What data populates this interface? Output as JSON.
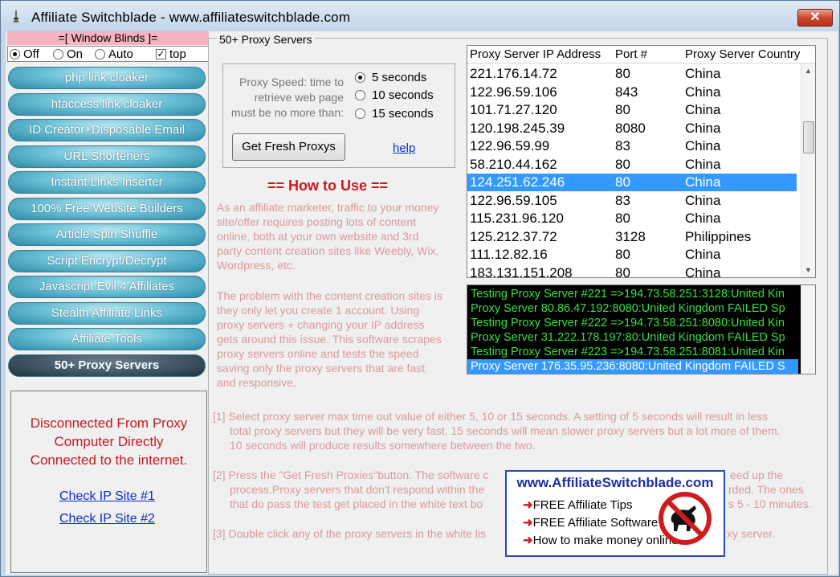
{
  "window": {
    "title": "Affiliate Switchblade - www.affiliateswitchblade.com",
    "close_label": "✕"
  },
  "sidebar": {
    "blinds_title": "=[ Window Blinds ]=",
    "blinds_options": [
      "Off",
      "On",
      "Auto"
    ],
    "blinds_selected": "Off",
    "top_label": "top",
    "top_checked": true,
    "nav": [
      {
        "label": "php link cloaker"
      },
      {
        "label": "htaccess link cloaker"
      },
      {
        "label": "ID Creator+Disposable Email"
      },
      {
        "label": "URL Shorteners"
      },
      {
        "label": "Instant Links Inserter"
      },
      {
        "label": "100% Free Website Builders"
      },
      {
        "label": "Article Spin Shuffle"
      },
      {
        "label": "Script Encrypt/Decrypt"
      },
      {
        "label": "Javascript Evil 4 Affiliates"
      },
      {
        "label": "Stealth Affiliate Links"
      },
      {
        "label": "Affiliate Tools"
      },
      {
        "label": "50+ Proxy Servers"
      }
    ],
    "active_nav": "50+ Proxy Servers",
    "status": {
      "line1": "Disconnected From Proxy",
      "line2": "Computer Directly",
      "line3": "Connected to the internet."
    },
    "links": {
      "ip1": "Check IP Site #1",
      "ip2": "Check IP Site #2"
    }
  },
  "main": {
    "group_label": "50+ Proxy Servers",
    "speed": {
      "label_line1": "Proxy Speed: time to",
      "label_line2": "retrieve web page",
      "label_line3": "must be no more than:",
      "options": [
        "5 seconds",
        "10 seconds",
        "15 seconds"
      ],
      "selected": "5 seconds"
    },
    "fresh_button": "Get Fresh Proxys",
    "help_link": "help",
    "how_title": "== How to Use ==",
    "intro_paragraph": [
      "As an affiliate marketer, traffic to your money",
      "site/offer requires posting lots of content",
      "online, both at your own website and 3rd",
      "party content creation sites like Weebly, Wix,",
      "Wordpress, etc."
    ],
    "problem_paragraph": [
      "The problem with the content creation sites is",
      "they only let you create 1 account. Using",
      "proxy servers + changing your IP address",
      "gets around this issue. This software scrapes",
      "proxy servers online and tests the speed",
      "saving only the proxy servers that are fast",
      "and responsive."
    ],
    "step1": [
      "[1] Select proxy server max time out value of either 5, 10 or 15 seconds. A setting of 5 seconds will result in less",
      "total proxy servers but they will be very fast. 15 seconds will mean slower proxy servers but a lot more of them.",
      "10 seconds will produce results somewhere between the two."
    ],
    "step2": [
      "[2] Press the \"Get Fresh Proxies\"button. The software c",
      "process.Proxy servers that don't respond within the",
      "that do pass the test get placed in the white text bo"
    ],
    "step2_right": [
      "eed up the",
      "rded. The ones",
      "s 5 - 10 minutes."
    ],
    "step3": "[3] Double click any of the proxy servers in the white lis",
    "step3_right": "xy server.",
    "table": {
      "headers": [
        "Proxy Server IP Address",
        "Port #",
        "Proxy Server Country"
      ],
      "rows": [
        {
          "ip": "221.176.14.72",
          "port": "80",
          "country": "China"
        },
        {
          "ip": "122.96.59.106",
          "port": "843",
          "country": "China"
        },
        {
          "ip": "101.71.27.120",
          "port": "80",
          "country": "China"
        },
        {
          "ip": "120.198.245.39",
          "port": "8080",
          "country": "China"
        },
        {
          "ip": "122.96.59.99",
          "port": "83",
          "country": "China"
        },
        {
          "ip": "58.210.44.162",
          "port": "80",
          "country": "China"
        },
        {
          "ip": "124.251.62.246",
          "port": "80",
          "country": "China"
        },
        {
          "ip": "122.96.59.105",
          "port": "83",
          "country": "China"
        },
        {
          "ip": "115.231.96.120",
          "port": "80",
          "country": "China"
        },
        {
          "ip": "125.212.37.72",
          "port": "3128",
          "country": "Philippines"
        },
        {
          "ip": "111.12.82.16",
          "port": "80",
          "country": "China"
        },
        {
          "ip": "183.131.151.208",
          "port": "80",
          "country": "China"
        }
      ],
      "selected_ip": "124.251.62.246"
    },
    "log": [
      "Testing Proxy Server #221 =>194.73.58.251:3128:United Kin",
      "Proxy Server 80.86.47.192:8080:United Kingdom FAILED Sp",
      "Testing Proxy Server #222 =>194.73.58.251:8080:United Kin",
      "Proxy Server 31.222.178.197:80:United Kingdom FAILED Sp",
      "Testing Proxy Server #223 =>194.73.58.251:8081:United Kin",
      "Proxy Server 176.35.95.236:8080:United Kingdom FAILED S"
    ],
    "ad": {
      "url": "www.AffiliateSwitchblade.com",
      "items": [
        "FREE Affiliate Tips",
        "FREE Affiliate Software",
        "How to make money online"
      ]
    }
  },
  "colors": {
    "accent_red": "#c8191f",
    "link_blue": "#0a2ec9",
    "selection_blue": "#3399ff",
    "log_green": "#36e33a"
  }
}
